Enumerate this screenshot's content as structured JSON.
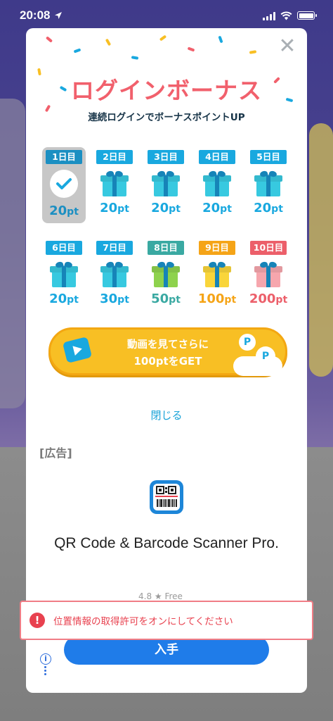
{
  "status_bar": {
    "time": "20:08"
  },
  "modal": {
    "close_glyph": "✕",
    "title": "ログインボーナス",
    "subtitle": "連続ログインでボーナスポイントUP",
    "days": [
      {
        "label": "1日目",
        "points": "20",
        "unit": "pt",
        "state": "done"
      },
      {
        "label": "2日目",
        "points": "20",
        "unit": "pt",
        "color": "#19a8df",
        "gift": "#37c9e0"
      },
      {
        "label": "3日目",
        "points": "20",
        "unit": "pt",
        "color": "#19a8df",
        "gift": "#37c9e0"
      },
      {
        "label": "4日目",
        "points": "20",
        "unit": "pt",
        "color": "#19a8df",
        "gift": "#37c9e0"
      },
      {
        "label": "5日目",
        "points": "20",
        "unit": "pt",
        "color": "#19a8df",
        "gift": "#37c9e0"
      },
      {
        "label": "6日目",
        "points": "20",
        "unit": "pt",
        "color": "#19a8df",
        "gift": "#37c9e0"
      },
      {
        "label": "7日目",
        "points": "30",
        "unit": "pt",
        "color": "#19a8df",
        "gift": "#37c9e0"
      },
      {
        "label": "8日目",
        "points": "50",
        "unit": "pt",
        "color": "#3aa9a2",
        "gift": "#8ed24d"
      },
      {
        "label": "9日目",
        "points": "100",
        "unit": "pt",
        "color": "#f5a417",
        "gift": "#f9d53a"
      },
      {
        "label": "10日目",
        "points": "200",
        "unit": "pt",
        "color": "#ec5f6a",
        "gift": "#f6a6ad"
      }
    ],
    "video_button": {
      "line1": "動画を見てさらに",
      "line2": "100ptをGET",
      "badge": "P"
    },
    "close_link": "閉じる",
    "ad": {
      "label": "[広告]",
      "app_title": "QR Code & Barcode Scanner Pro.",
      "rating": "4.8 ★   Free",
      "install": "入手",
      "info_glyph": "i"
    }
  },
  "toast": {
    "icon": "!",
    "text": "位置情報の取得許可をオンにしてください"
  }
}
